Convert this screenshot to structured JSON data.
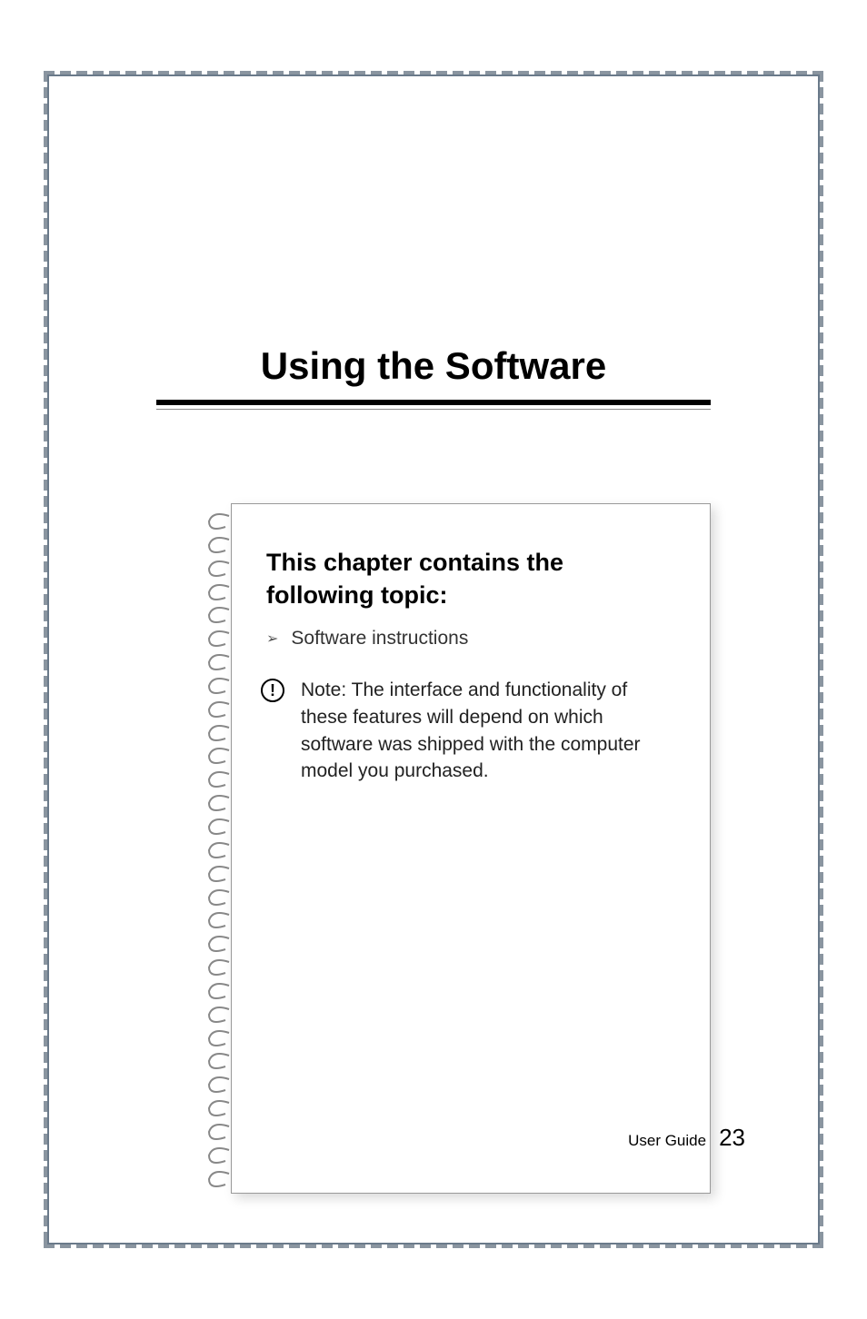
{
  "chapter": {
    "title": "Using the Software"
  },
  "content": {
    "heading": "This chapter contains the following topic:",
    "bullet": {
      "text": "Software instructions"
    },
    "note": {
      "label": "Note:",
      "text": " The interface and functionality of these features will depend on which software was shipped with the computer model you purchased."
    }
  },
  "footer": {
    "doc_type": "User Guide",
    "page_number": "23"
  }
}
